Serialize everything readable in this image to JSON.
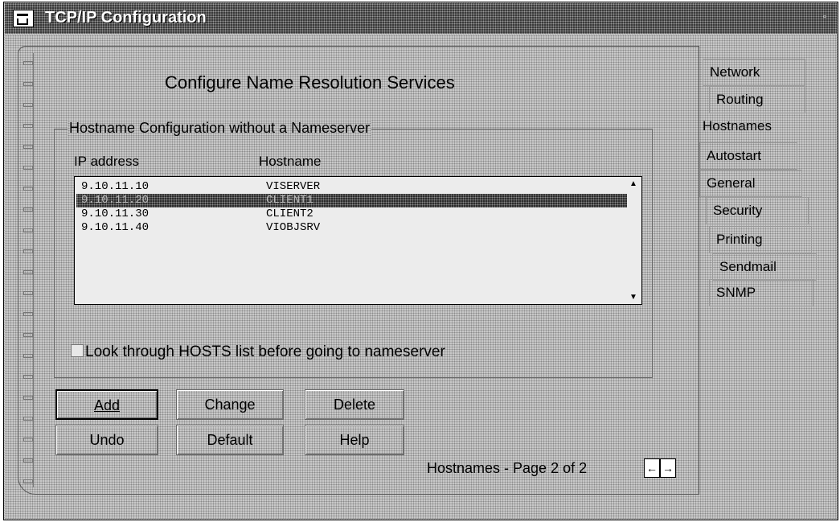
{
  "window": {
    "title": "TCP/IP Configuration"
  },
  "notebook": {
    "page_title": "Configure  Name  Resolution  Services",
    "group_label": "Hostname Configuration without a Nameserver",
    "columns": [
      "IP address",
      "Hostname"
    ],
    "rows": [
      {
        "ip": "9.10.11.10",
        "host": "VISERVER",
        "selected": false
      },
      {
        "ip": "9.10.11.20",
        "host": "CLIENT1",
        "selected": true
      },
      {
        "ip": "9.10.11.30",
        "host": "CLIENT2",
        "selected": false
      },
      {
        "ip": "9.10.11.40",
        "host": "VIOBJSRV",
        "selected": false
      }
    ],
    "checkbox_label": "Look through HOSTS list before going to nameserver",
    "checkbox_checked": false,
    "buttons": {
      "add": "Add",
      "change": "Change",
      "delete": "Delete",
      "undo": "Undo",
      "default": "Default",
      "help": "Help"
    },
    "page_indicator": "Hostnames - Page 2 of 2",
    "tabs": [
      "Network",
      "Routing",
      "Hostnames",
      "Autostart",
      "General",
      "Security",
      "Printing",
      "Sendmail",
      "SNMP"
    ],
    "active_tab": "Hostnames"
  }
}
